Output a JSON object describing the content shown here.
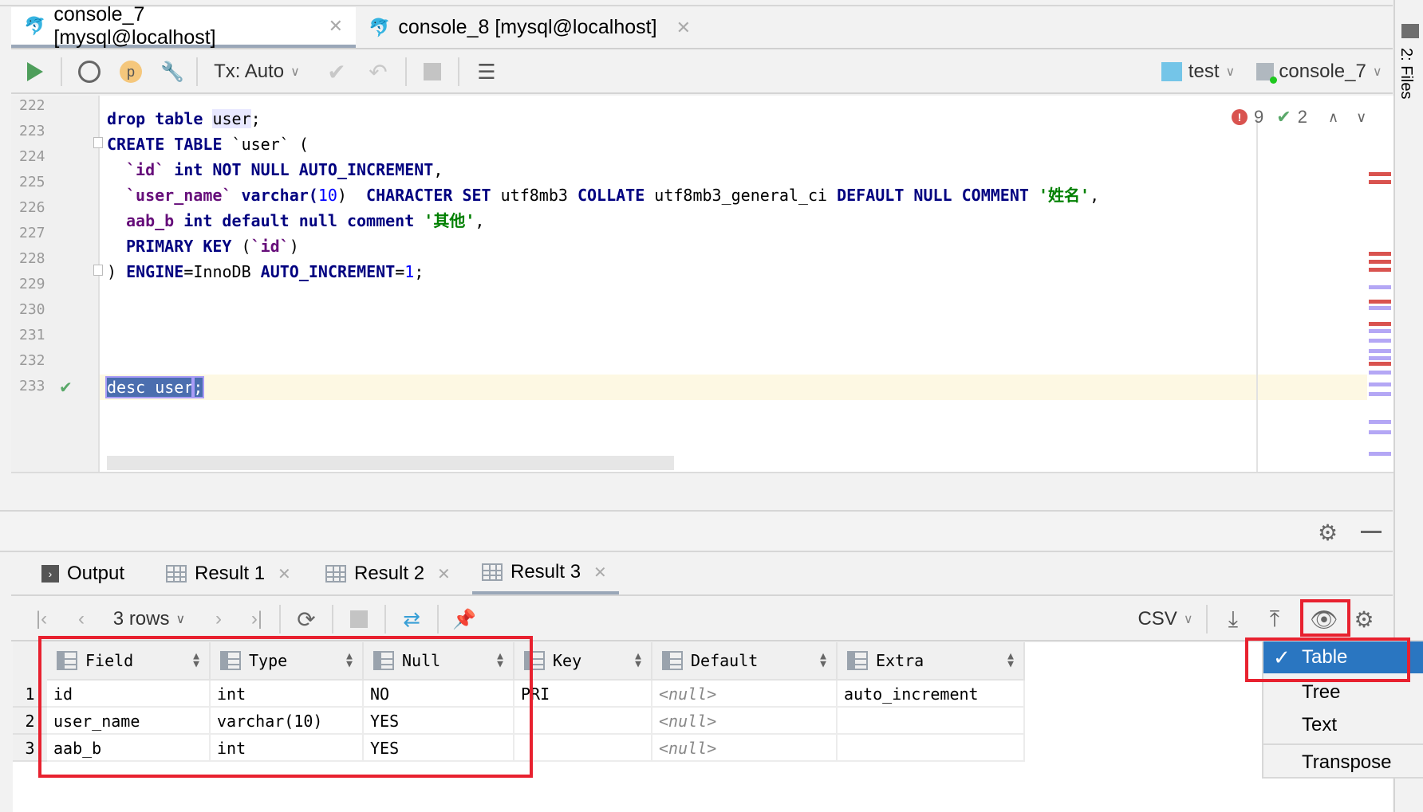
{
  "editor_tabs": [
    {
      "label": "console_7 [mysql@localhost]",
      "active": true
    },
    {
      "label": "console_8 [mysql@localhost]",
      "active": false
    }
  ],
  "toolbar": {
    "tx_mode": "Tx: Auto",
    "schema": "test",
    "session": "console_7"
  },
  "inspections": {
    "errors": "9",
    "ok": "2"
  },
  "code_lines": [
    "222",
    "223",
    "224",
    "225",
    "226",
    "227",
    "228",
    "229",
    "230",
    "231",
    "232",
    "233"
  ],
  "code": {
    "l223": [
      "drop table ",
      "user",
      ";"
    ],
    "l224": [
      "CREATE TABLE ",
      "`user`",
      " ("
    ],
    "l225": [
      "`id`",
      " int NOT NULL AUTO_INCREMENT",
      ","
    ],
    "l226": [
      "`user_name`",
      " varchar(",
      "10",
      ")  ",
      "CHARACTER SET",
      " utf8mb3 ",
      "COLLATE",
      " utf8mb3_general_ci ",
      "DEFAULT NULL COMMENT",
      " ",
      "'姓名'",
      ","
    ],
    "l227": [
      "aab_b",
      " int default null comment ",
      "'其他'",
      ","
    ],
    "l228": [
      "PRIMARY KEY",
      " (",
      "`id`",
      ")"
    ],
    "l229": [
      ") ",
      "ENGINE",
      "=InnoDB ",
      "AUTO_INCREMENT",
      "=",
      "1",
      ";"
    ],
    "l233": [
      "desc user",
      ";"
    ]
  },
  "side_panel": {
    "files_label": "2: Files"
  },
  "result_tabs": [
    {
      "label": "Output"
    },
    {
      "label": "Result 1"
    },
    {
      "label": "Result 2"
    },
    {
      "label": "Result 3",
      "active": true
    }
  ],
  "result_toolbar": {
    "rows": "3 rows",
    "export_format": "CSV"
  },
  "table": {
    "columns": [
      "Field",
      "Type",
      "Null",
      "Key",
      "Default",
      "Extra"
    ],
    "rows": [
      {
        "n": "1",
        "cells": [
          "id",
          "int",
          "NO",
          "PRI",
          "<null>",
          "auto_increment"
        ]
      },
      {
        "n": "2",
        "cells": [
          "user_name",
          "varchar(10)",
          "YES",
          "",
          "<null>",
          ""
        ]
      },
      {
        "n": "3",
        "cells": [
          "aab_b",
          "int",
          "YES",
          "",
          "<null>",
          ""
        ]
      }
    ]
  },
  "view_menu": {
    "items": [
      {
        "label": "Table",
        "checked": true
      },
      {
        "label": "Tree"
      },
      {
        "label": "Text"
      },
      {
        "label": "Transpose"
      }
    ]
  },
  "colors": {
    "selection": "#2a76c1",
    "highlight_box": "#e8212f",
    "keyword": "#000080",
    "string": "#008000"
  }
}
